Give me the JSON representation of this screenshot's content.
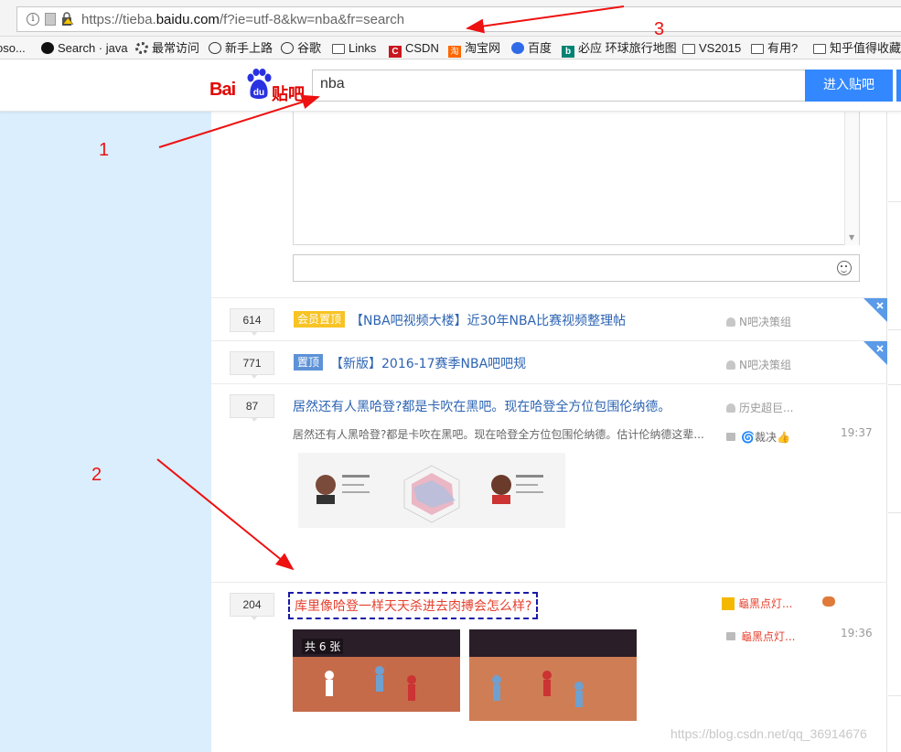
{
  "browser": {
    "url_prefix": "https://tieba.",
    "url_domain": "baidu.com",
    "url_suffix": "/f?ie=utf-8&kw=nba&fr=search"
  },
  "bookmarks": [
    {
      "label": "oso...",
      "icon": "none"
    },
    {
      "label": "Search · java",
      "icon": "github-icon"
    },
    {
      "label": "最常访问",
      "icon": "gear-icon"
    },
    {
      "label": "新手上路",
      "icon": "globe-icon"
    },
    {
      "label": "谷歌",
      "icon": "globe-icon"
    },
    {
      "label": "Links",
      "icon": "folder-icon"
    },
    {
      "label": "CSDN",
      "icon": "csdn-icon"
    },
    {
      "label": "淘宝网",
      "icon": "taobao-icon"
    },
    {
      "label": "百度",
      "icon": "baidu-paw-icon"
    },
    {
      "label": "必应 环球旅行地图",
      "icon": "bing-icon"
    },
    {
      "label": "VS2015",
      "icon": "folder-icon"
    },
    {
      "label": "有用?",
      "icon": "folder-icon"
    },
    {
      "label": "知乎值得收藏的",
      "icon": "folder-icon"
    }
  ],
  "header": {
    "logo_bai": "Bai",
    "logo_du": "du",
    "logo_tieba": "贴吧",
    "search_value": "nba",
    "search_button": "进入贴吧"
  },
  "threads": [
    {
      "replies": "614",
      "tag": "会员置顶",
      "title": "【NBA吧视频大楼】近30年NBA比赛视频整理帖",
      "author": "N吧决策组"
    },
    {
      "replies": "771",
      "tag": "置顶",
      "title": "【新版】2016-17赛季NBA吧吧规",
      "author": "N吧决策组"
    },
    {
      "replies": "87",
      "title": "居然还有人黑哈登?都是卡吹在黑吧。现在哈登全方位包围伦纳德。",
      "author": "历史超巨...",
      "excerpt": "居然还有人黑哈登?都是卡吹在黑吧。现在哈登全方位包围伦纳德。估计伦纳德这辈...",
      "last_reply": "裁决",
      "time": "19:37"
    },
    {
      "replies": "204",
      "title": "库里像哈登一样天天杀进去肉搏会怎么样?",
      "author": "龜黑点灯...",
      "last_reply": "龜黑点灯...",
      "time": "19:36",
      "image_count": "共 6 张"
    }
  ],
  "annotations": {
    "n1": "1",
    "n2": "2",
    "n3": "3"
  },
  "watermark": "https://blog.csdn.net/qq_36914676",
  "colors": {
    "accent": "#3388ff",
    "annotation": "#e11111",
    "link": "#2d64b3"
  }
}
